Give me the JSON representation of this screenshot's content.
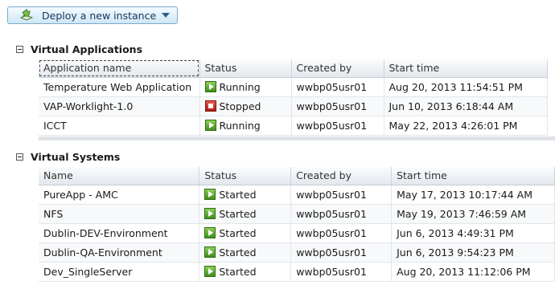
{
  "toolbar": {
    "deploy_label": "Deploy a new instance"
  },
  "virtual_applications": {
    "title": "Virtual Applications",
    "columns": [
      "Application name",
      "Status",
      "Created by",
      "Start time"
    ],
    "rows": [
      {
        "name": "Temperature Web Application",
        "status": "Running",
        "status_icon": "start-icon",
        "created_by": "wwbp05usr01",
        "start_time": "Aug 20, 2013 11:54:51 PM"
      },
      {
        "name": "VAP-Worklight-1.0",
        "status": "Stopped",
        "status_icon": "stop-icon",
        "created_by": "wwbp05usr01",
        "start_time": "Jun 10, 2013 6:18:44 AM"
      },
      {
        "name": "ICCT",
        "status": "Running",
        "status_icon": "start-icon",
        "created_by": "wwbp05usr01",
        "start_time": "May 22, 2013 4:26:01 PM"
      }
    ]
  },
  "virtual_systems": {
    "title": "Virtual Systems",
    "columns": [
      "Name",
      "Status",
      "Created by",
      "Start time"
    ],
    "rows": [
      {
        "name": "PureApp - AMC",
        "status": "Started",
        "status_icon": "start-icon",
        "created_by": "wwbp05usr01",
        "start_time": "May 17, 2013 10:17:44 AM"
      },
      {
        "name": "NFS",
        "status": "Started",
        "status_icon": "start-icon",
        "created_by": "wwbp05usr01",
        "start_time": "May 19, 2013 7:46:59 AM"
      },
      {
        "name": "Dublin-DEV-Environment",
        "status": "Started",
        "status_icon": "start-icon",
        "created_by": "wwbp05usr01",
        "start_time": "Jun 6, 2013 4:49:31 PM"
      },
      {
        "name": "Dublin-QA-Environment",
        "status": "Started",
        "status_icon": "start-icon",
        "created_by": "wwbp05usr01",
        "start_time": "Jun 6, 2013 9:54:23 PM"
      },
      {
        "name": "Dev_SingleServer",
        "status": "Started",
        "status_icon": "start-icon",
        "created_by": "wwbp05usr01",
        "start_time": "Aug 20, 2013 11:12:06 PM"
      }
    ]
  }
}
